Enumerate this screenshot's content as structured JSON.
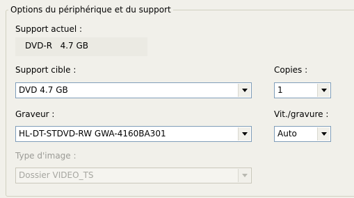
{
  "group": {
    "title": "Options du périphérique et du support"
  },
  "current_media": {
    "label": "Support actuel :",
    "value": "DVD-R   4.7 GB"
  },
  "target_media": {
    "label": "Support cible :",
    "selected": "DVD 4.7 GB"
  },
  "copies": {
    "label": "Copies :",
    "selected": "1"
  },
  "burner": {
    "label": "Graveur :",
    "selected": "HL-DT-STDVD-RW GWA-4160BA301"
  },
  "write_speed": {
    "label": "Vit./gravure :",
    "selected": "Auto"
  },
  "image_type": {
    "label": "Type d'image :",
    "selected": "Dossier VIDEO_TS",
    "disabled": true
  }
}
